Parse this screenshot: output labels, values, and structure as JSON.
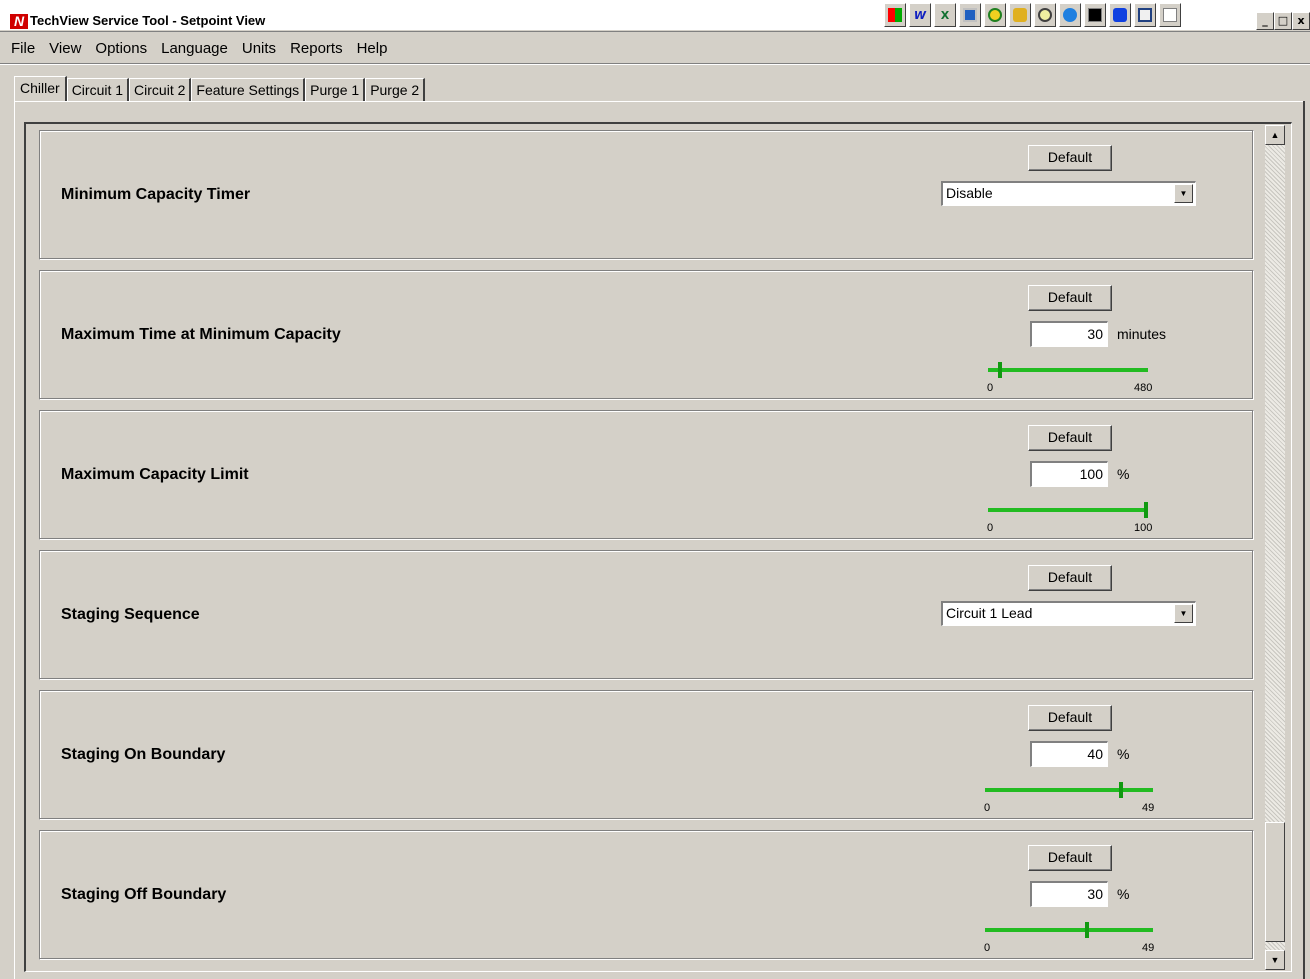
{
  "window": {
    "title": "TechView Service Tool - Setpoint View",
    "logo_letter": "N",
    "minimize": "_",
    "maximize": "□",
    "close": "x"
  },
  "menu": [
    "File",
    "View",
    "Options",
    "Language",
    "Units",
    "Reports",
    "Help"
  ],
  "tabs": [
    "Chiller",
    "Circuit 1",
    "Circuit 2",
    "Feature Settings",
    "Purge 1",
    "Purge 2"
  ],
  "active_tab": "Chiller",
  "default_label": "Default",
  "settings": [
    {
      "label": "Minimum Capacity Timer",
      "control": "dropdown",
      "value": "Disable"
    },
    {
      "label": "Maximum Time at Minimum Capacity",
      "control": "number",
      "value": "30",
      "unit": "minutes",
      "min": "0",
      "max": "480",
      "position": 0.0625
    },
    {
      "label": "Maximum Capacity Limit",
      "control": "number",
      "value": "100",
      "unit": "%",
      "min": "0",
      "max": "100",
      "position": 1.0
    },
    {
      "label": "Staging Sequence",
      "control": "dropdown",
      "value": "Circuit 1 Lead"
    },
    {
      "label": "Staging On Boundary",
      "control": "number",
      "value": "40",
      "unit": "%",
      "min": "0",
      "max": "49",
      "position": 0.816
    },
    {
      "label": "Staging Off Boundary",
      "control": "number",
      "value": "30",
      "unit": "%",
      "min": "0",
      "max": "49",
      "position": 0.612
    }
  ],
  "tray_icons": [
    "tray-app-icon",
    "word-icon",
    "excel-icon",
    "screen-icon",
    "clock-icon",
    "key-icon",
    "search-icon",
    "browser-icon",
    "terminal-icon",
    "refresh-icon",
    "window-icon",
    "calendar-icon"
  ]
}
